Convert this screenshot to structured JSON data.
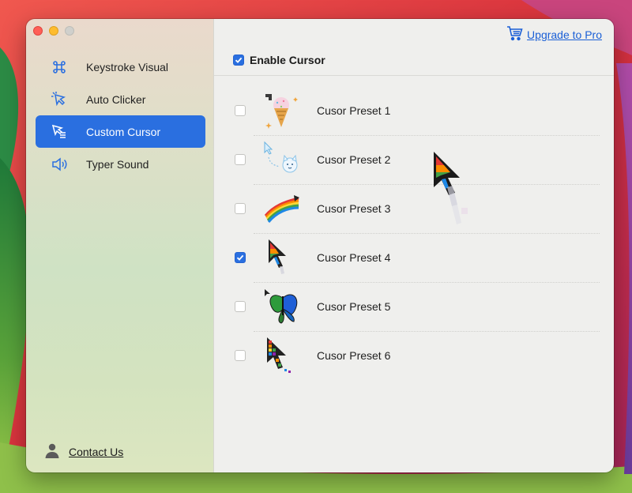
{
  "sidebar": {
    "items": [
      {
        "label": "Keystroke Visual",
        "icon": "command-icon",
        "active": false
      },
      {
        "label": "Auto Clicker",
        "icon": "cursor-click-icon",
        "active": false
      },
      {
        "label": "Custom Cursor",
        "icon": "cursor-list-icon",
        "active": true
      },
      {
        "label": "Typer Sound",
        "icon": "speaker-icon",
        "active": false
      }
    ],
    "contact_label": "Contact Us"
  },
  "header": {
    "upgrade_label": "Upgrade to Pro",
    "enable_label": "Enable Cursor",
    "enable_checked": true
  },
  "presets": [
    {
      "label": "Cusor Preset 1",
      "checked": false,
      "thumb": "ice-cream-cursor"
    },
    {
      "label": "Cusor Preset 2",
      "checked": false,
      "thumb": "cat-cursor"
    },
    {
      "label": "Cusor Preset 3",
      "checked": false,
      "thumb": "rainbow-trail-cursor"
    },
    {
      "label": "Cusor Preset 4",
      "checked": true,
      "thumb": "rainbow-arrow-cursor"
    },
    {
      "label": "Cusor Preset 5",
      "checked": false,
      "thumb": "butterfly-cursor"
    },
    {
      "label": "Cusor Preset 6",
      "checked": false,
      "thumb": "rainbow-dotted-cursor"
    }
  ],
  "colors": {
    "accent": "#2a6fe0",
    "link": "#1a5fd6"
  }
}
